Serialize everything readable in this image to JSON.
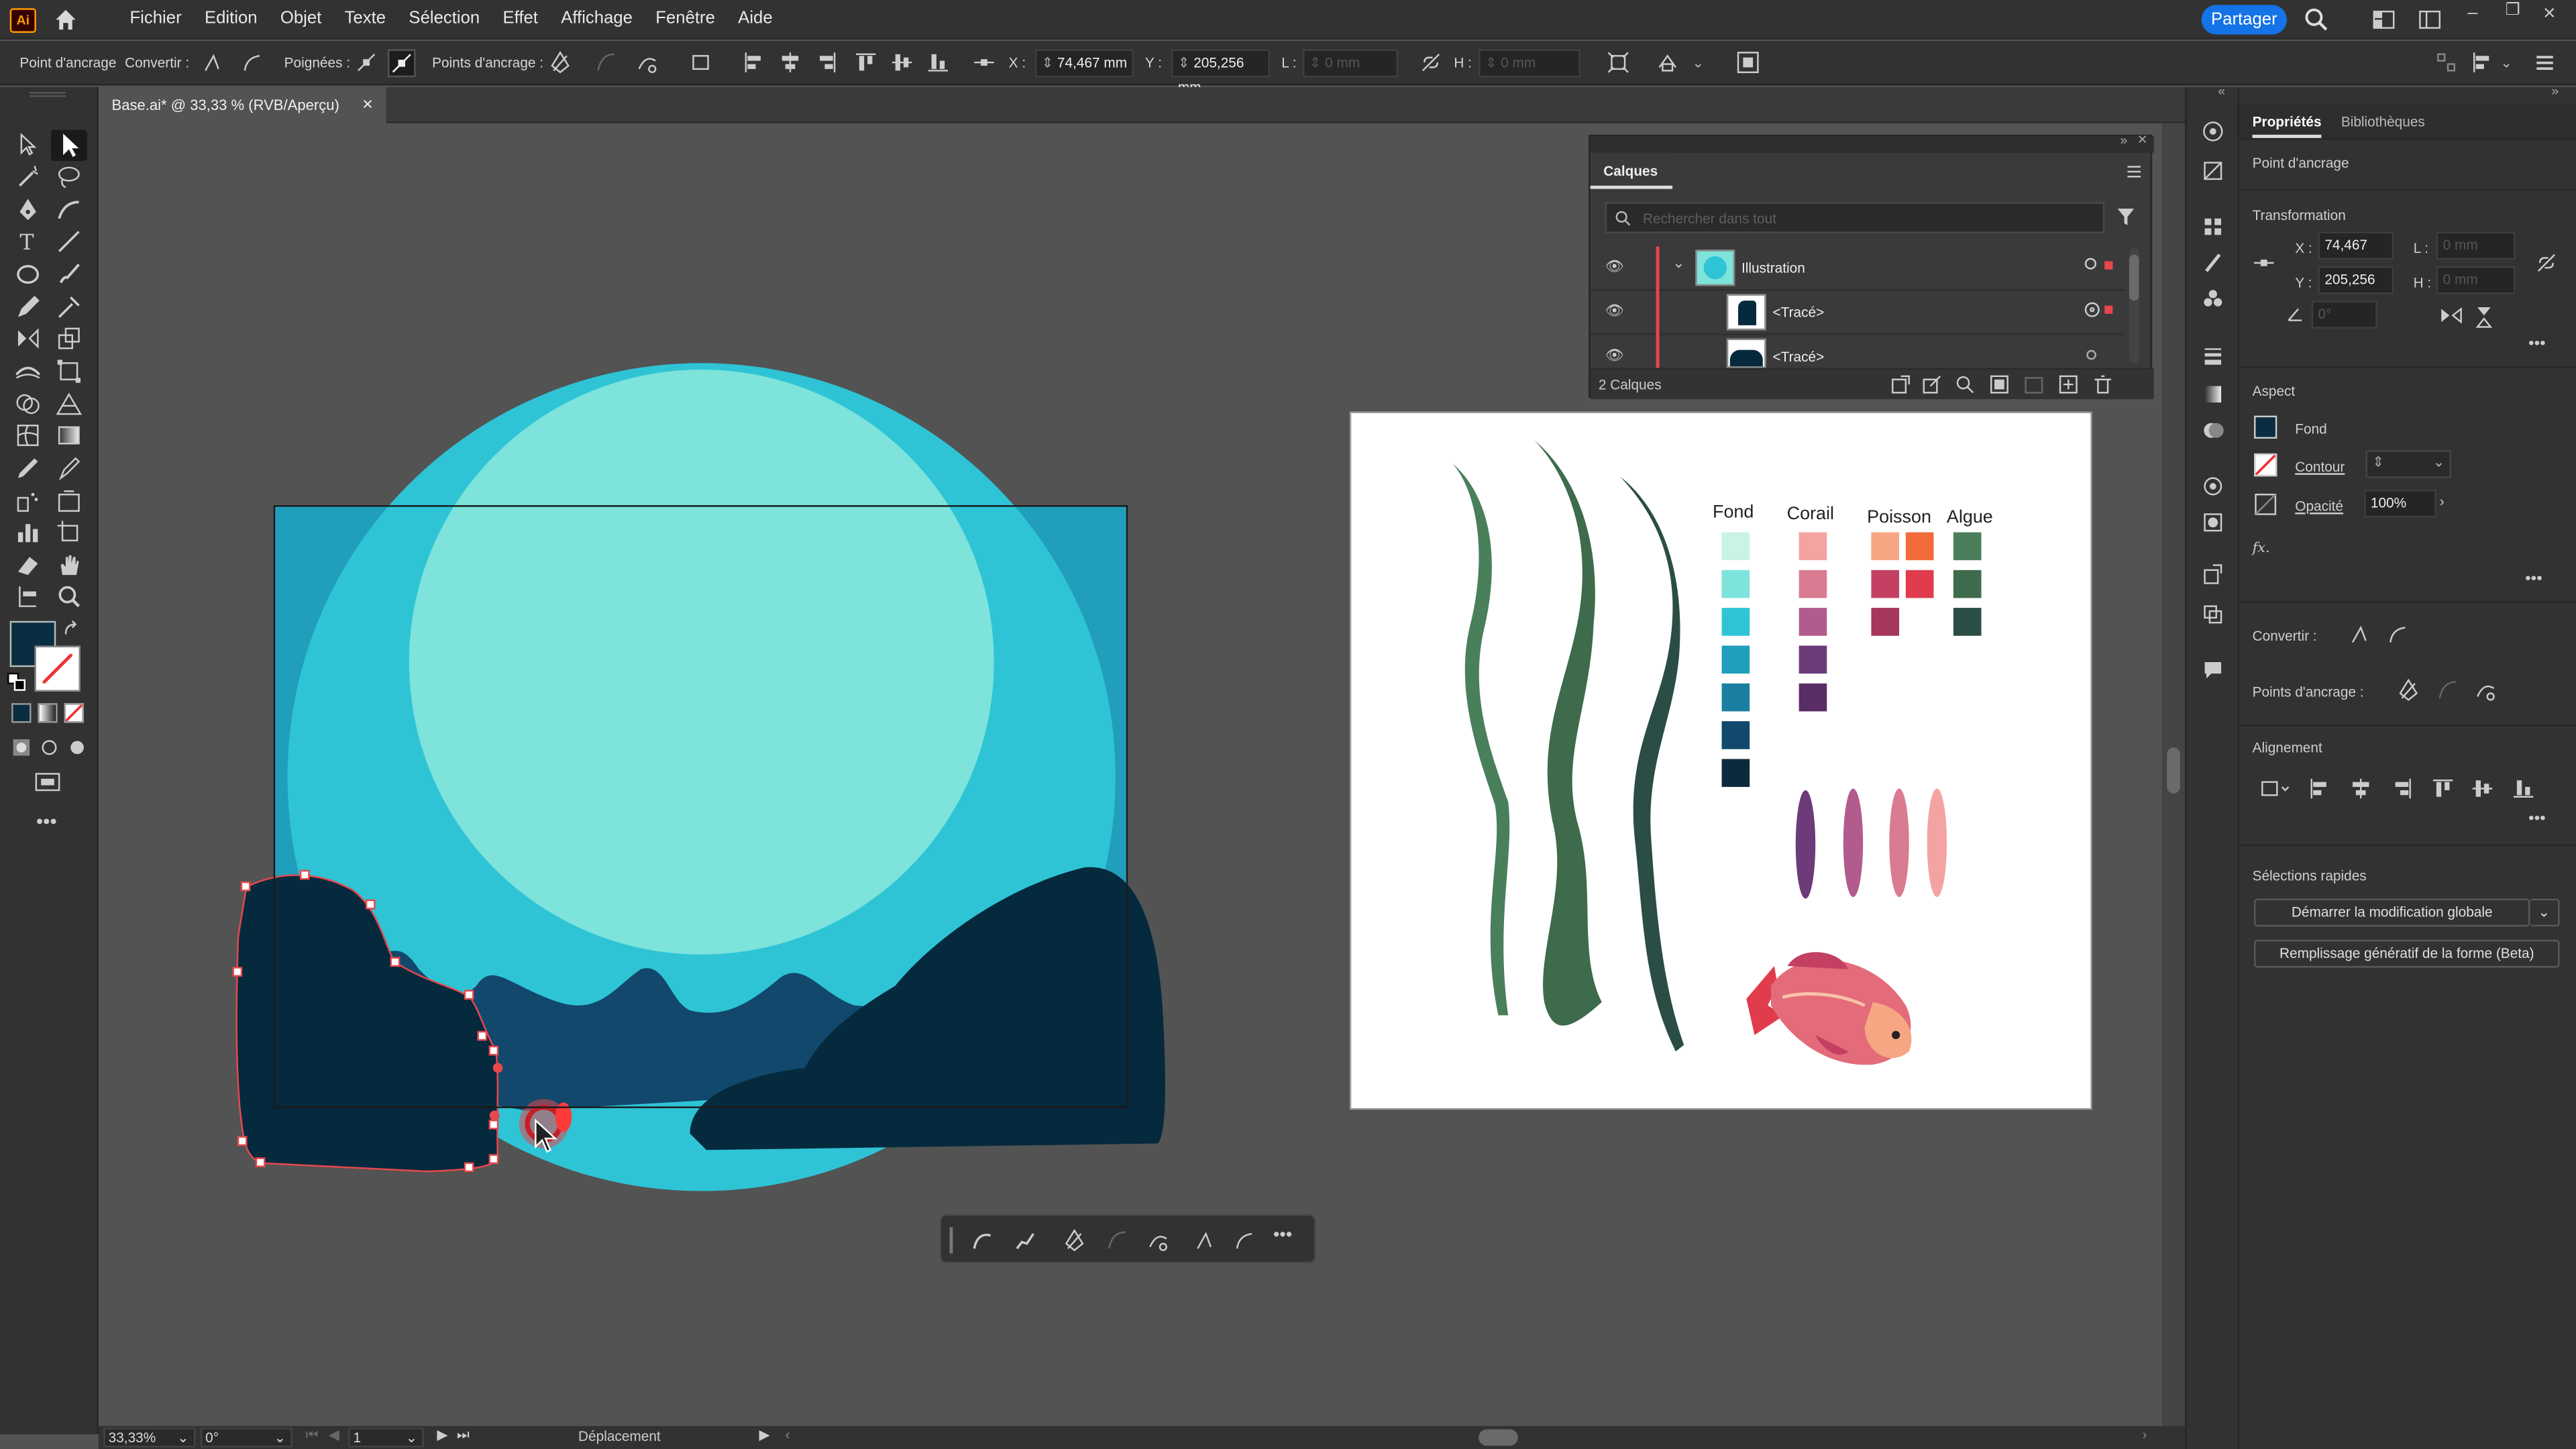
{
  "app": {
    "logo": "Ai",
    "share_label": "Partager"
  },
  "menu": [
    "Fichier",
    "Edition",
    "Objet",
    "Texte",
    "Sélection",
    "Effet",
    "Affichage",
    "Fenêtre",
    "Aide"
  ],
  "control_bar": {
    "anchor_label": "Point d'ancrage",
    "convert_label": "Convertir :",
    "handles_label": "Poignées :",
    "anchors_label": "Points d'ancrage :",
    "x_label": "X :",
    "x_value": "74,467 mm",
    "y_label": "Y :",
    "y_value": "205,256 mm",
    "l_label": "L :",
    "l_value": "0 mm",
    "h_label": "H :",
    "h_value": "0 mm"
  },
  "document_tab": {
    "title": "Base.ai* @ 33,33 % (RVB/Aperçu)",
    "close": "×"
  },
  "layers_panel": {
    "title": "Calques",
    "search_placeholder": "Rechercher dans tout",
    "rows": [
      {
        "name": "Illustration"
      },
      {
        "name": "<Tracé>"
      },
      {
        "name": "<Tracé>"
      }
    ],
    "count": "2 Calques"
  },
  "palette": {
    "headers": [
      "Fond",
      "Corail",
      "Poisson",
      "Algue"
    ],
    "fond": [
      "#c8f3e6",
      "#7de3db",
      "#2ec4d6",
      "#219ebc",
      "#1b7fa1",
      "#11486b",
      "#0a2b3c"
    ],
    "corail": [
      "#f4a3a3",
      "#d97b91",
      "#b15c8c",
      "#6d3a7a",
      "#5a2d66"
    ],
    "poisson": [
      "#f7a683",
      "#f26b3a",
      "#c44063",
      "#e03c4b",
      "#a6365b"
    ],
    "algue": [
      "#4a7f5c",
      "#3d6b4b",
      "#2a4d46"
    ],
    "colors": {
      "sun": "#7de3db",
      "sky": "#2ec4d6",
      "bg_rect": "#219ebc",
      "rock": "#05293d",
      "mid": "#11486b",
      "selection": "#e8474c"
    }
  },
  "status_bar": {
    "zoom": "33,33%",
    "rotation": "0°",
    "page": "1",
    "tool": "Déplacement"
  },
  "properties_panel": {
    "tabs": [
      "Propriétés",
      "Bibliothèques"
    ],
    "object_type": "Point d'ancrage",
    "transform_title": "Transformation",
    "x_label": "X :",
    "x_value": "74,467 mm",
    "y_label": "Y :",
    "y_value": "205,256 mm",
    "l_label": "L :",
    "l_value": "0 mm",
    "h_label": "H :",
    "h_value": "0 mm",
    "angle_value": "0°",
    "aspect_title": "Aspect",
    "fill_label": "Fond",
    "stroke_label": "Contour",
    "opacity_label": "Opacité",
    "opacity_value": "100%",
    "fx_label": "fx.",
    "convert_label": "Convertir :",
    "anchors_label": "Points d'ancrage :",
    "align_title": "Alignement",
    "quick_title": "Sélections rapides",
    "global_edit_button": "Démarrer la modification globale",
    "generative_fill_button": "Remplissage génératif de la forme (Beta)"
  }
}
